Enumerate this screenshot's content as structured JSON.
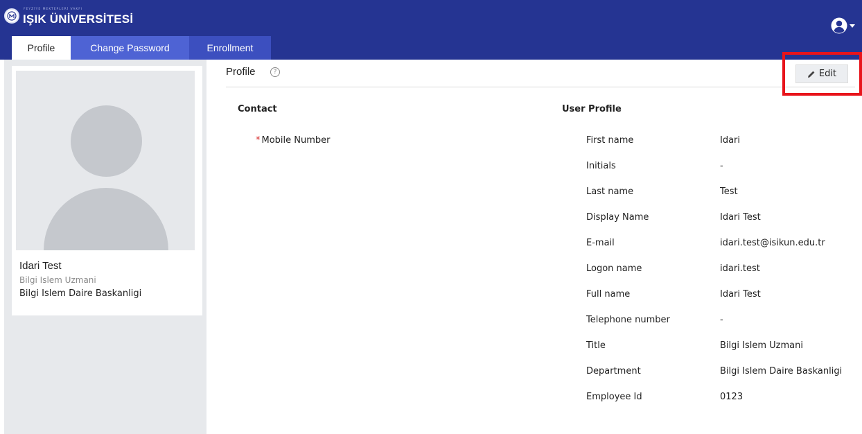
{
  "app": {
    "logo_subtitle": "FEYZİYE MEKTEPLERİ VAKFI",
    "logo_name": "IŞIK ÜNİVERSİTESİ"
  },
  "header": {
    "user_menu_icon": "user-circle-icon",
    "colors": {
      "bar": "#253492",
      "tab_password": "#4e63d4",
      "tab_enrollment": "#3c4fbf"
    }
  },
  "tabs": [
    {
      "label": "Profile",
      "active": true
    },
    {
      "label": "Change Password",
      "active": false
    },
    {
      "label": "Enrollment",
      "active": false
    }
  ],
  "sidebar": {
    "name": "Idari Test",
    "title": "Bilgi Islem Uzmani",
    "department": "Bilgi Islem Daire Baskanligi"
  },
  "main": {
    "title": "Profile",
    "help_icon": "?",
    "edit_label": "Edit",
    "highlight_color": "#e8141b",
    "contact": {
      "heading": "Contact",
      "required_mark": "*",
      "mobile_label": "Mobile Number"
    },
    "user_profile": {
      "heading": "User Profile",
      "fields": [
        {
          "label": "First name",
          "value": "Idari"
        },
        {
          "label": "Initials",
          "value": "-"
        },
        {
          "label": "Last name",
          "value": "Test"
        },
        {
          "label": "Display Name",
          "value": "Idari Test"
        },
        {
          "label": "E-mail",
          "value": "idari.test@isikun.edu.tr"
        },
        {
          "label": "Logon name",
          "value": "idari.test"
        },
        {
          "label": "Full name",
          "value": "Idari Test"
        },
        {
          "label": "Telephone number",
          "value": "-"
        },
        {
          "label": "Title",
          "value": "Bilgi Islem Uzmani"
        },
        {
          "label": "Department",
          "value": "Bilgi Islem Daire Baskanligi"
        },
        {
          "label": "Employee Id",
          "value": "0123"
        }
      ]
    }
  }
}
